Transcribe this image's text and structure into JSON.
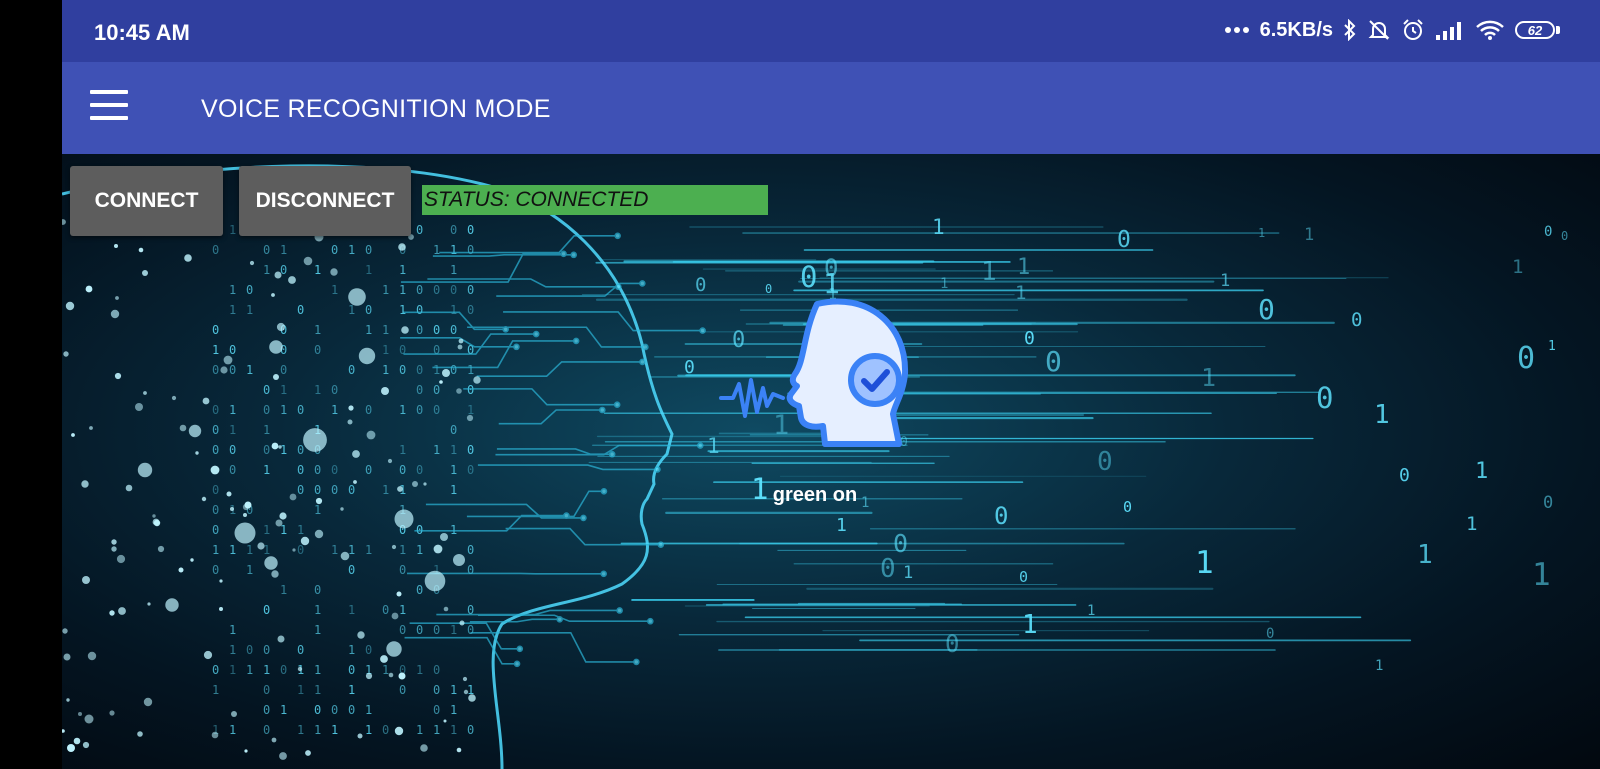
{
  "status_bar": {
    "time": "10:45 AM",
    "network_speed": "6.5KB/s",
    "battery_level": "62",
    "icons": [
      "more-dots-icon",
      "bluetooth-icon",
      "mute-icon",
      "alarm-icon",
      "signal-icon",
      "wifi-icon",
      "battery-icon"
    ]
  },
  "toolbar": {
    "menu_icon": "hamburger-menu-icon",
    "title": "VOICE RECOGNITION MODE",
    "background": "#3f51b5"
  },
  "controls": {
    "connect_label": "CONNECT",
    "disconnect_label": "DISCONNECT",
    "status_text": "STATUS: CONNECTED",
    "status_color": "#4caf50"
  },
  "voice": {
    "icon": "voice-recognition-head-icon",
    "recognized_text": "green on"
  },
  "colors": {
    "status_bar": "#303f9f",
    "button": "#5d5d5d",
    "accent_cyan": "#35c8e8"
  }
}
